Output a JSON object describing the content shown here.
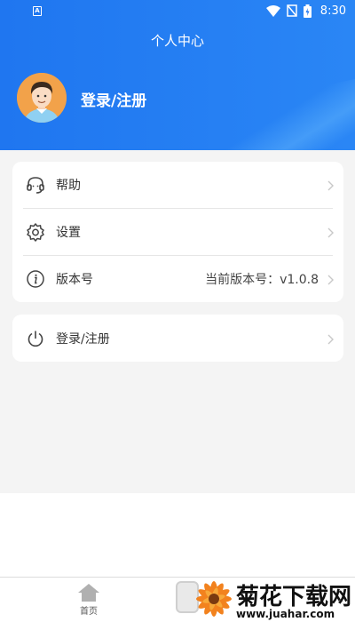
{
  "status_bar": {
    "time": "8:30",
    "left_icon": "A",
    "icons": [
      "wifi-icon",
      "no-signal-icon",
      "battery-charging-icon"
    ]
  },
  "header": {
    "title": "个人中心",
    "user_label": "登录/注册",
    "background_color": "#1f76f0"
  },
  "menu": {
    "items": [
      {
        "icon": "headset-icon",
        "label": "帮助",
        "value": ""
      },
      {
        "icon": "gear-icon",
        "label": "设置",
        "value": ""
      },
      {
        "icon": "info-icon",
        "label": "版本号",
        "value": "当前版本号：v1.0.8"
      }
    ],
    "login": {
      "icon": "power-icon",
      "label": "登录/注册"
    }
  },
  "bottom_nav": {
    "items": [
      {
        "icon": "home-icon",
        "label": "首页"
      }
    ]
  },
  "watermark": {
    "title": "菊花下载网",
    "url": "www.juahar.com"
  }
}
